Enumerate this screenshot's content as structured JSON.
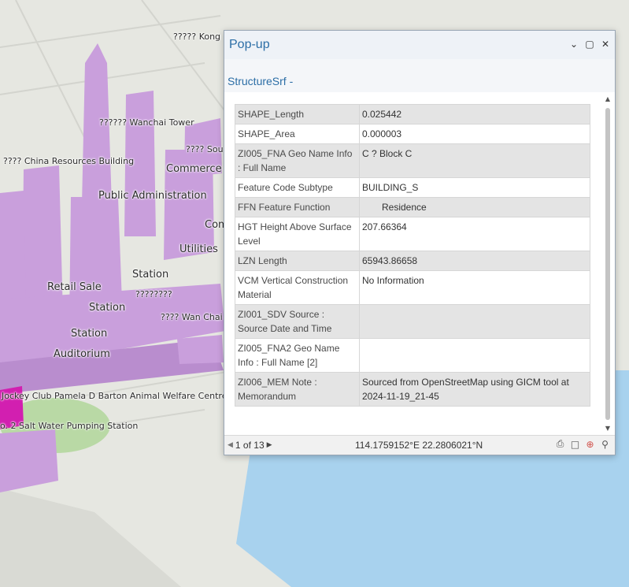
{
  "map": {
    "labels": [
      "????? Kong",
      "?????? Wanchai Tower",
      "???? Sou",
      "???? China Resources Building",
      "Commerce",
      "Public Administration",
      "Com",
      "Utilities",
      "Station",
      "Retail Sale",
      "????????",
      "Station",
      "???? Wan Chai",
      "Station",
      "Auditorium",
      "Jockey Club Pamela D Barton Animal Welfare Centre",
      "o. 2 Salt Water Pumping Station"
    ],
    "colors": {
      "building": "#c99fdc",
      "building_shadow": "#a77bc0",
      "highlight": "#d21fb0",
      "water": "#a8d2ee",
      "land": "#e6e7e1",
      "park": "#b9d9a5"
    }
  },
  "popup": {
    "title": "Pop-up",
    "layer_title": "StructureSrf -",
    "window_icons": [
      "chevron-down-icon",
      "maximize-icon",
      "close-icon"
    ],
    "attributes": [
      {
        "field": "SHAPE_Length",
        "value": "0.025442"
      },
      {
        "field": "SHAPE_Area",
        "value": "0.000003"
      },
      {
        "field": "ZI005_FNA Geo Name Info : Full Name",
        "value": "C ? Block C"
      },
      {
        "field": "Feature Code Subtype",
        "value": "BUILDING_S"
      },
      {
        "field": "FFN Feature Function",
        "value": "Residence"
      },
      {
        "field": "HGT Height Above Surface Level",
        "value": "207.66364"
      },
      {
        "field": "LZN Length",
        "value": "65943.86658"
      },
      {
        "field": "VCM Vertical Construction Material",
        "value": "No Information"
      },
      {
        "field": "ZI001_SDV Source : Source Date and Time",
        "value": ""
      },
      {
        "field": "ZI005_FNA2 Geo Name Info : Full Name [2]",
        "value": ""
      },
      {
        "field": "ZI006_MEM Note : Memorandum",
        "value": "Sourced from OpenStreetMap using GICM tool at 2024-11-19_21-45"
      }
    ],
    "footer": {
      "page_text": "1 of 13",
      "coordinates": "114.1759152°E 22.2806021°N",
      "tool_icons": [
        "print-icon",
        "export-icon",
        "locate-icon",
        "zoom-to-icon"
      ]
    }
  }
}
